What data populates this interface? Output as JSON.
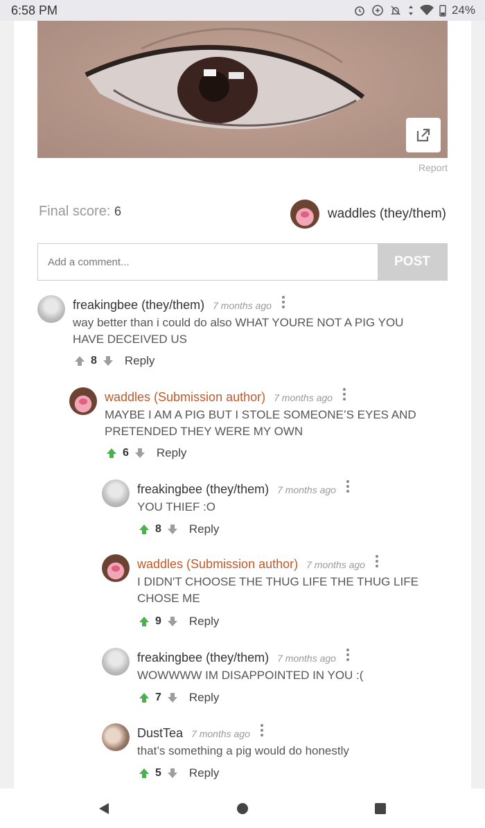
{
  "status_bar": {
    "time": "6:58 PM",
    "battery": "24%"
  },
  "post": {
    "report_label": "Report",
    "final_score_label": "Final score:",
    "final_score_value": "6",
    "author": "waddles (they/them)"
  },
  "comment_form": {
    "placeholder": "Add a comment...",
    "post_label": "POST"
  },
  "comments": [
    {
      "author": "freakingbee (they/them)",
      "time": "7 months ago",
      "lines": [
        "way better than i could do also WHAT YOURE NOT A PIG YOU",
        "HAVE DECEIVED US"
      ],
      "votes": "8",
      "reply": "Reply",
      "avatar": "gray-avatar",
      "upvoted": false
    },
    {
      "author": "waddles (Submission author)",
      "time": "7 months ago",
      "lines": [
        "MAYBE I AM A PIG BUT I STOLE SOMEONE’S EYES AND",
        "PRETENDED THEY WERE MY OWN"
      ],
      "votes": "6",
      "reply": "Reply",
      "avatar": "pig-avatar",
      "upvoted": true
    },
    {
      "author": "freakingbee (they/them)",
      "time": "7 months ago",
      "lines": [
        "YOU THIEF :O"
      ],
      "votes": "8",
      "reply": "Reply",
      "avatar": "gray-avatar",
      "upvoted": true
    },
    {
      "author": "waddles (Submission author)",
      "time": "7 months ago",
      "lines": [
        "I DIDN'T CHOOSE THE THUG LIFE THE THUG LIFE",
        "CHOSE ME"
      ],
      "votes": "9",
      "reply": "Reply",
      "avatar": "pig-avatar",
      "upvoted": true
    },
    {
      "author": "freakingbee (they/them)",
      "time": "7 months ago",
      "lines": [
        "WOWWWW IM DISAPPOINTED IN YOU :("
      ],
      "votes": "7",
      "reply": "Reply",
      "avatar": "gray-avatar",
      "upvoted": true
    },
    {
      "author": "DustTea",
      "time": "7 months ago",
      "lines": [
        "that’s something a pig would do honestly"
      ],
      "votes": "5",
      "reply": "Reply",
      "avatar": "photo-avatar",
      "upvoted": true
    }
  ],
  "colors": {
    "upvote": "#4caf50",
    "neutral_arrow": "#9e9e9e",
    "submission_author": "#c05a2a"
  }
}
